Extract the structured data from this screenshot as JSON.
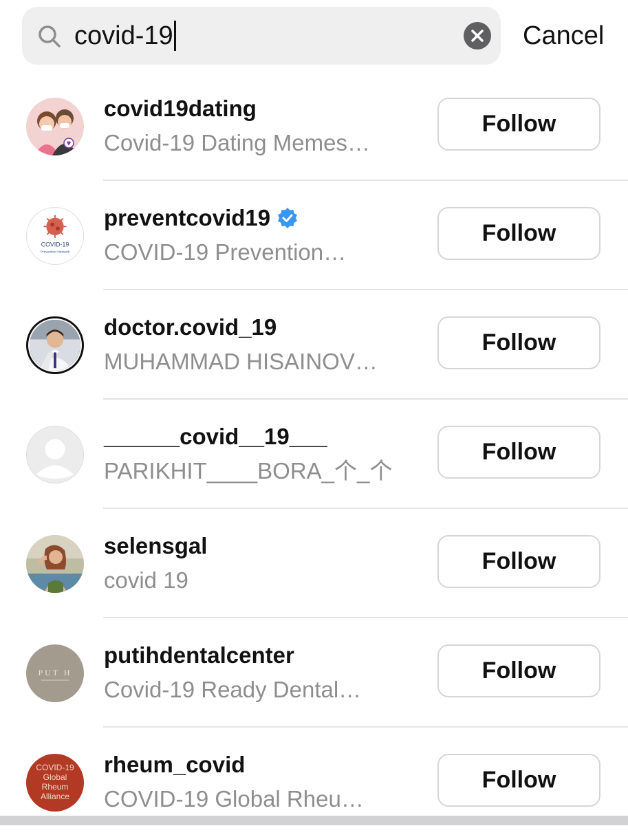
{
  "search": {
    "query": "covid-19",
    "cancel_label": "Cancel"
  },
  "results": [
    {
      "username": "covid19dating",
      "subtitle": "Covid-19 Dating Memes…",
      "follow_label": "Follow",
      "verified": false
    },
    {
      "username": "preventcovid19",
      "subtitle": "COVID-19 Prevention…",
      "follow_label": "Follow",
      "verified": true,
      "avatar_text": [
        "COVID-19",
        "Prevention Network"
      ]
    },
    {
      "username": "doctor.covid_19",
      "subtitle": "MUHAMMAD HISAINOV…",
      "follow_label": "Follow",
      "verified": false
    },
    {
      "username": "______covid__19___",
      "subtitle": "PARIKHIT____BORA_个_个",
      "follow_label": "Follow",
      "verified": false
    },
    {
      "username": "selensgal",
      "subtitle": "covid 19",
      "follow_label": "Follow",
      "verified": false
    },
    {
      "username": "putihdentalcenter",
      "subtitle": "Covid-19 Ready Dental…",
      "follow_label": "Follow",
      "verified": false,
      "avatar_text": [
        "PUT H"
      ]
    },
    {
      "username": "rheum_covid",
      "subtitle": "COVID-19 Global Rheu…",
      "follow_label": "Follow",
      "verified": false,
      "avatar_text": [
        "COVID-19",
        "Global",
        "Rheum",
        "Alliance"
      ]
    }
  ],
  "colors": {
    "verified_badge": "#3897f0",
    "secondary_text": "#8e8e8e",
    "search_background": "#efefef"
  },
  "icons": {
    "search": "magnifier-icon",
    "clear": "clear-x-icon",
    "verified": "verified-check-icon"
  }
}
